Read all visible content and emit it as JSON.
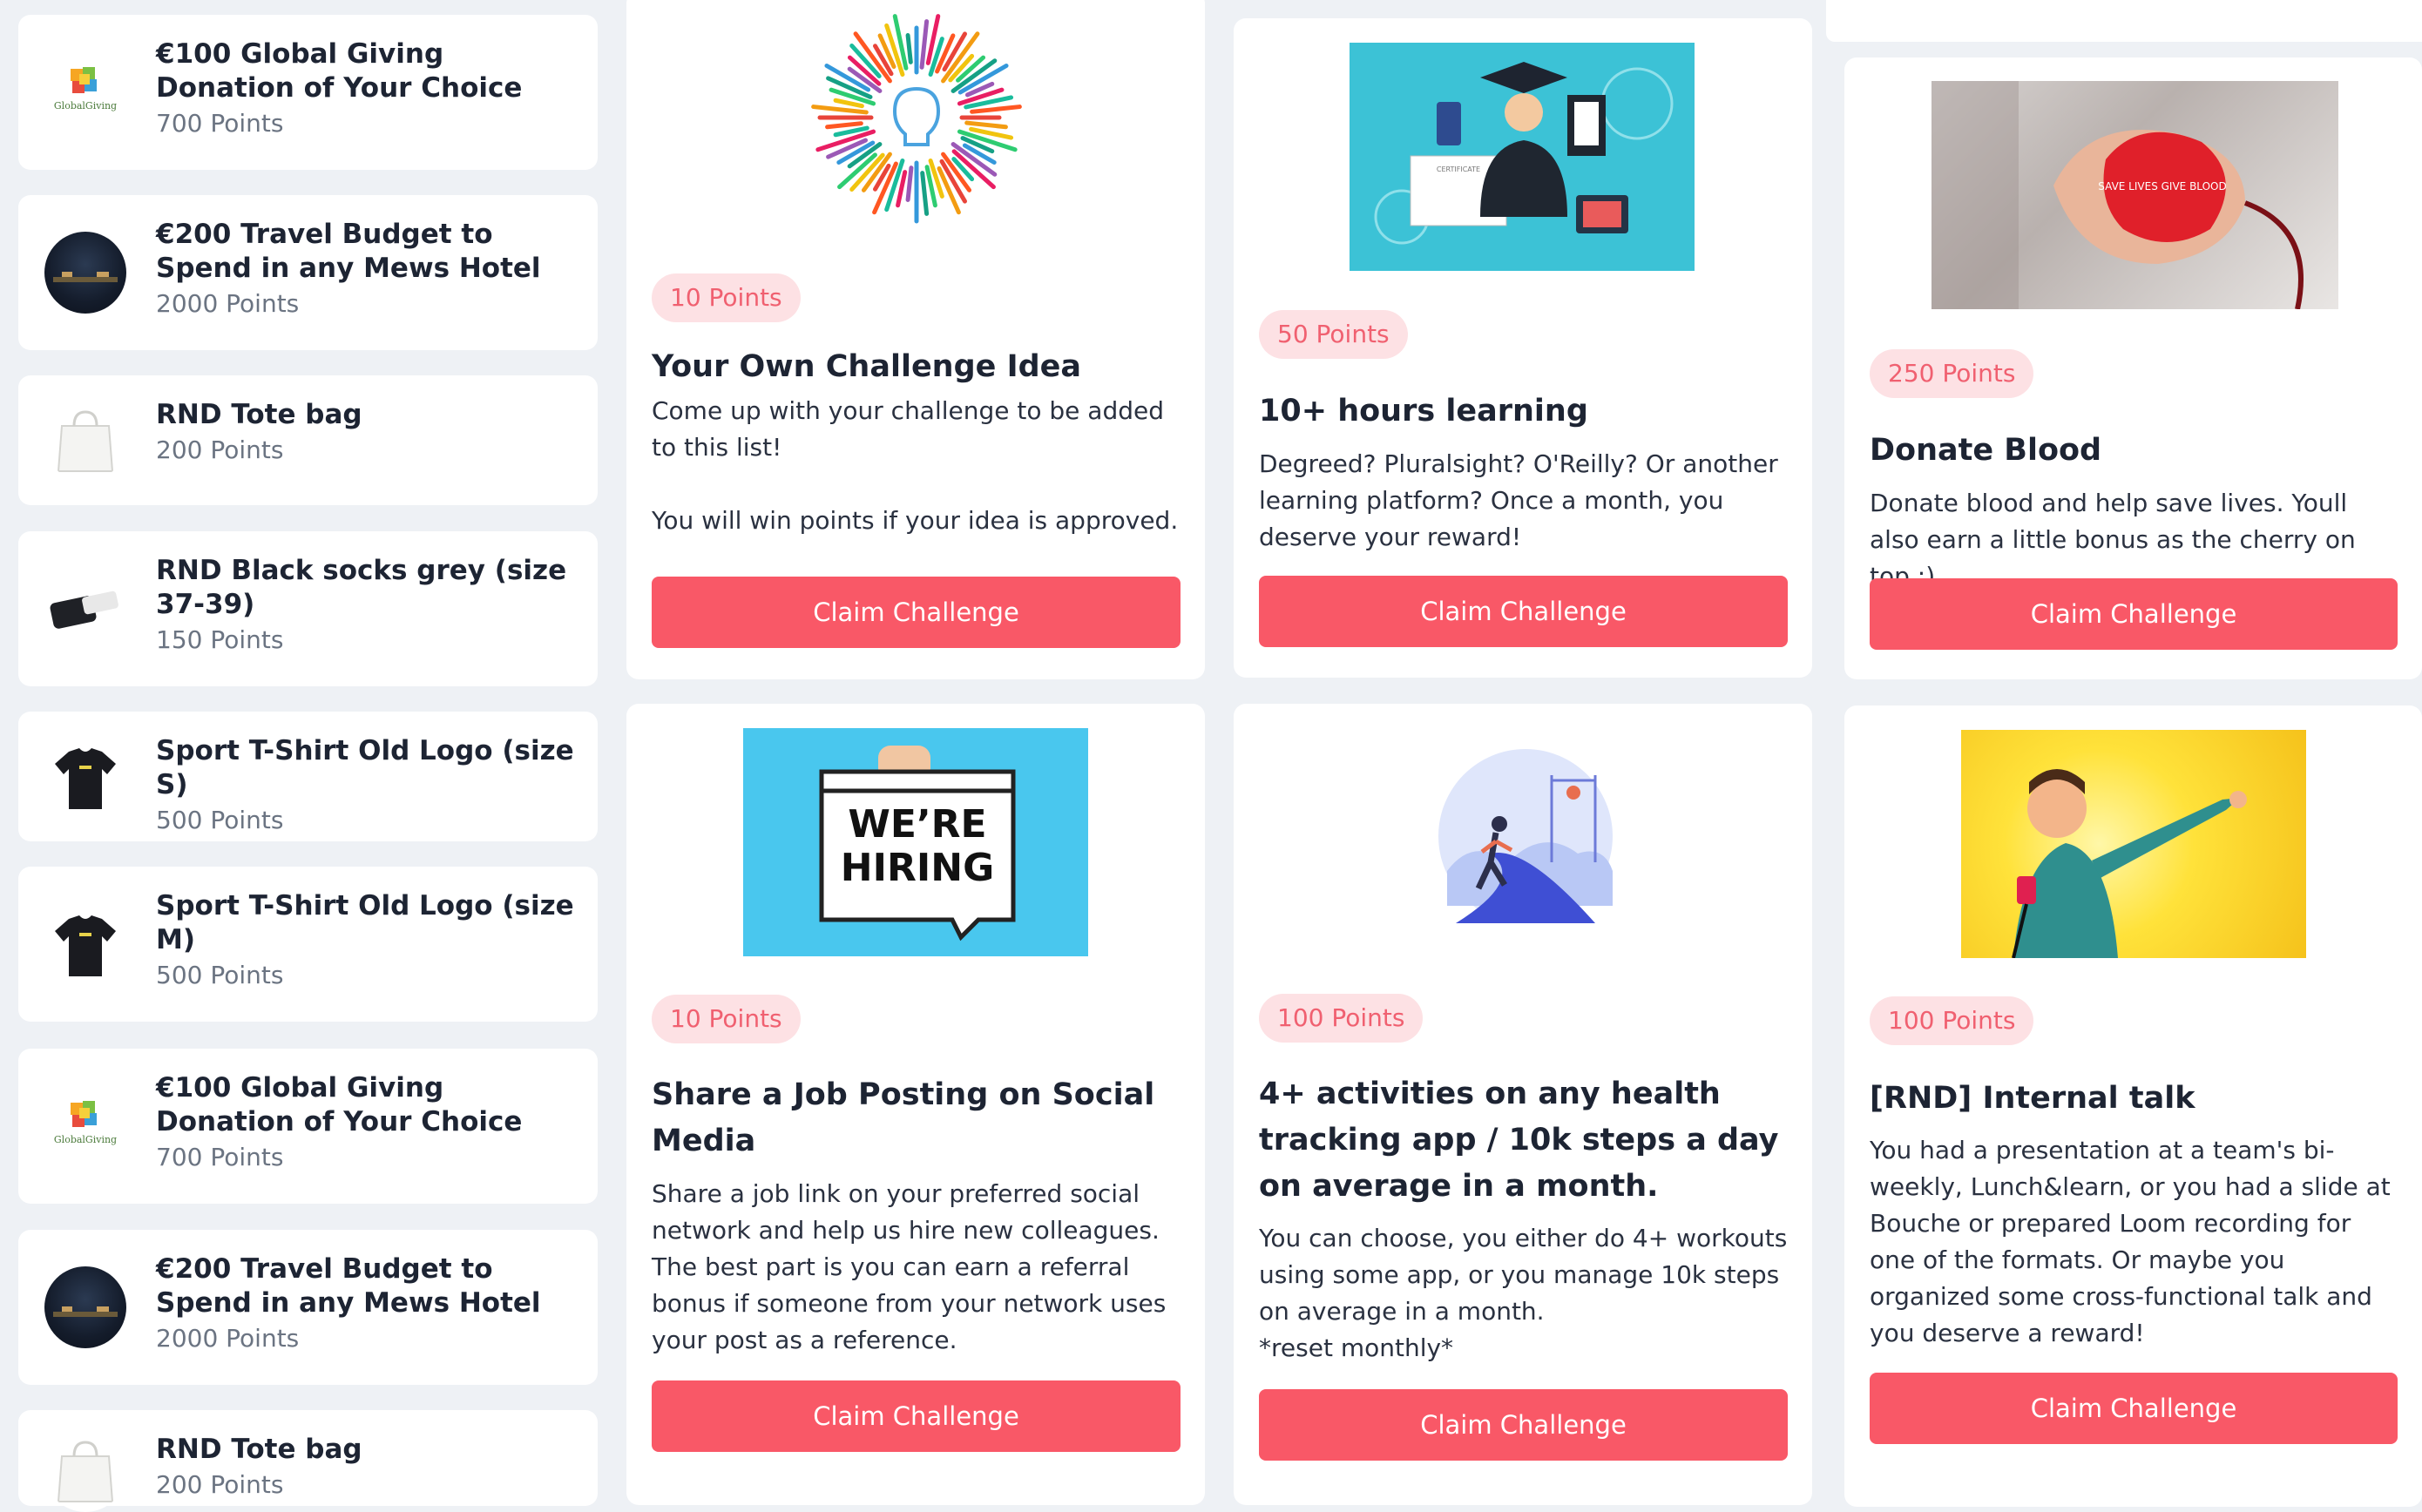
{
  "rewards": [
    {
      "title": "€100 Global Giving Donation of Your Choice",
      "points": "700 Points",
      "icon": "globalgiving-logo",
      "logo_text": "GlobalGiving"
    },
    {
      "title": "€200 Travel Budget to Spend in any Mews Hotel",
      "points": "2000 Points",
      "icon": "hotel-photo"
    },
    {
      "title": "RND Tote bag",
      "points": "200 Points",
      "icon": "tote-bag-photo"
    },
    {
      "title": "RND Black socks grey (size 37-39)",
      "points": "150 Points",
      "icon": "socks-photo"
    },
    {
      "title": "Sport T-Shirt Old Logo (size S)",
      "points": "500 Points",
      "icon": "tshirt-photo"
    },
    {
      "title": "Sport T-Shirt Old Logo (size M)",
      "points": "500 Points",
      "icon": "tshirt-photo"
    },
    {
      "title": "€100 Global Giving Donation of Your Choice",
      "points": "700 Points",
      "icon": "globalgiving-logo",
      "logo_text": "GlobalGiving"
    },
    {
      "title": "€200 Travel Budget to Spend in any Mews Hotel",
      "points": "2000 Points",
      "icon": "hotel-photo"
    },
    {
      "title": "RND Tote bag",
      "points": "200 Points",
      "icon": "tote-bag-photo"
    }
  ],
  "challenges": [
    {
      "points": "10 Points",
      "title": "Your Own Challenge Idea",
      "description": "Come up with your challenge to be added to this list!\n\nYou will win points if your idea is approved.",
      "button": "Claim Challenge",
      "image": "lightbulb-illustration"
    },
    {
      "points": "50 Points",
      "title": "10+ hours learning",
      "description": "Degreed? Pluralsight? O'Reilly? Or another learning platform? Once a month, you deserve your reward!",
      "button": "Claim Challenge",
      "image": "graduate-illustration",
      "image_text": "CERTIFICATE"
    },
    {
      "points": "250 Points",
      "title": "Donate Blood",
      "description": "Donate blood and help save lives. Youll also earn a little bonus as the cherry on top :)",
      "button": "Claim Challenge",
      "image": "blood-donation-photo",
      "image_text": "SAVE LIVES GIVE BLOOD"
    },
    {
      "points": "10 Points",
      "title": "Share a Job Posting on Social Media",
      "description": "Share a job link on your preferred social network and help us hire new colleagues. The best part is you can earn a referral bonus if someone from your network uses your post as a reference.",
      "button": "Claim Challenge",
      "image": "hiring-sign-photo",
      "image_text": "WE’RE HIRING"
    },
    {
      "points": "100 Points",
      "title": "4+ activities on any health tracking app / 10k steps a day on average in a month.",
      "description": "You can choose, you either do 4+ workouts using some app, or you manage 10k steps on average in a month.\n*reset monthly*",
      "button": "Claim Challenge",
      "image": "running-illustration"
    },
    {
      "points": "100 Points",
      "title": "[RND] Internal talk",
      "description": "You had a presentation at a team's bi-weekly, Lunch&learn, or you had a slide at Bouche or prepared Loom recording for one of the formats. Or maybe you organized some cross-functional talk and you deserve a reward!",
      "button": "Claim Challenge",
      "image": "presenter-illustration"
    }
  ],
  "colors": {
    "accent": "#f95867",
    "badge_bg": "#fde1e4",
    "badge_text": "#f06070",
    "page_bg": "#eef1f5"
  }
}
